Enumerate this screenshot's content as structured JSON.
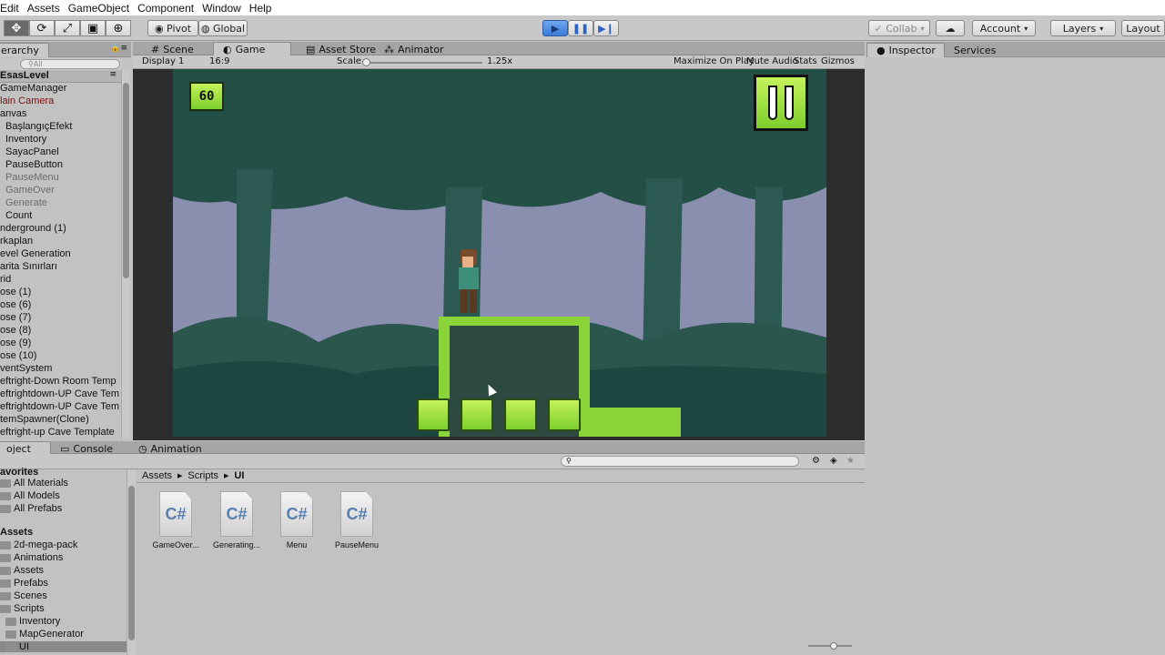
{
  "menu": [
    "Edit",
    "Assets",
    "GameObject",
    "Component",
    "Window",
    "Help"
  ],
  "toolbar": {
    "pivot": "Pivot",
    "global": "Global",
    "collab": "Collab",
    "account": "Account",
    "layers": "Layers",
    "layout": "Layout"
  },
  "tabs": {
    "hierarchy": "erarchy",
    "scene": "Scene",
    "game": "Game",
    "asset_store": "Asset Store",
    "animator": "Animator",
    "inspector": "Inspector",
    "services": "Services",
    "project": "oject",
    "console": "Console",
    "animation": "Animation"
  },
  "hierarchy": {
    "search_placeholder": "All",
    "scene_name": "EsasLevel",
    "items": [
      "GameManager",
      "lain Camera",
      "anvas",
      "BaşlangıçEfekt",
      "Inventory",
      "SayacPanel",
      "PauseButton",
      "PauseMenu",
      "GameOver",
      "Generate",
      "Count",
      "nderground (1)",
      "rkaplan",
      "evel Generation",
      "arita Sınırları",
      "rid",
      "ose (1)",
      "ose (6)",
      "ose (7)",
      "ose (8)",
      "ose (9)",
      "ose (10)",
      "ventSystem",
      "eftright-Down Room Temp",
      "eftrightdown-UP Cave Tem",
      "eftrightdown-UP Cave Tem",
      "temSpawner(Clone)",
      "eftright-up Cave Template"
    ]
  },
  "gamebar": {
    "display": "Display 1",
    "aspect": "16:9",
    "scale_label": "Scale",
    "scale_value": "1.25x",
    "maximize": "Maximize On Play",
    "mute": "Mute Audio",
    "stats": "Stats",
    "gizmos": "Gizmos"
  },
  "game": {
    "counter": "60",
    "pause_icon": "pause-icon"
  },
  "project": {
    "breadcrumb": [
      "Assets",
      "Scripts",
      "UI"
    ],
    "favorites": "avorites",
    "fav_items": [
      "All Materials",
      "All Models",
      "All Prefabs"
    ],
    "assets_label": "Assets",
    "folders": [
      "2d-mega-pack",
      "Animations",
      "Assets",
      "Prefabs",
      "Scenes",
      "Scripts",
      "Inventory",
      "MapGenerator",
      "UI"
    ],
    "files": [
      "GameOver...",
      "Generating...",
      "Menu",
      "PauseMenu"
    ],
    "file_icon_text": "C#"
  },
  "colors": {
    "play_active": "#3e7bd8",
    "game_bg": "#1f4b45",
    "tile": "#9de03a"
  }
}
